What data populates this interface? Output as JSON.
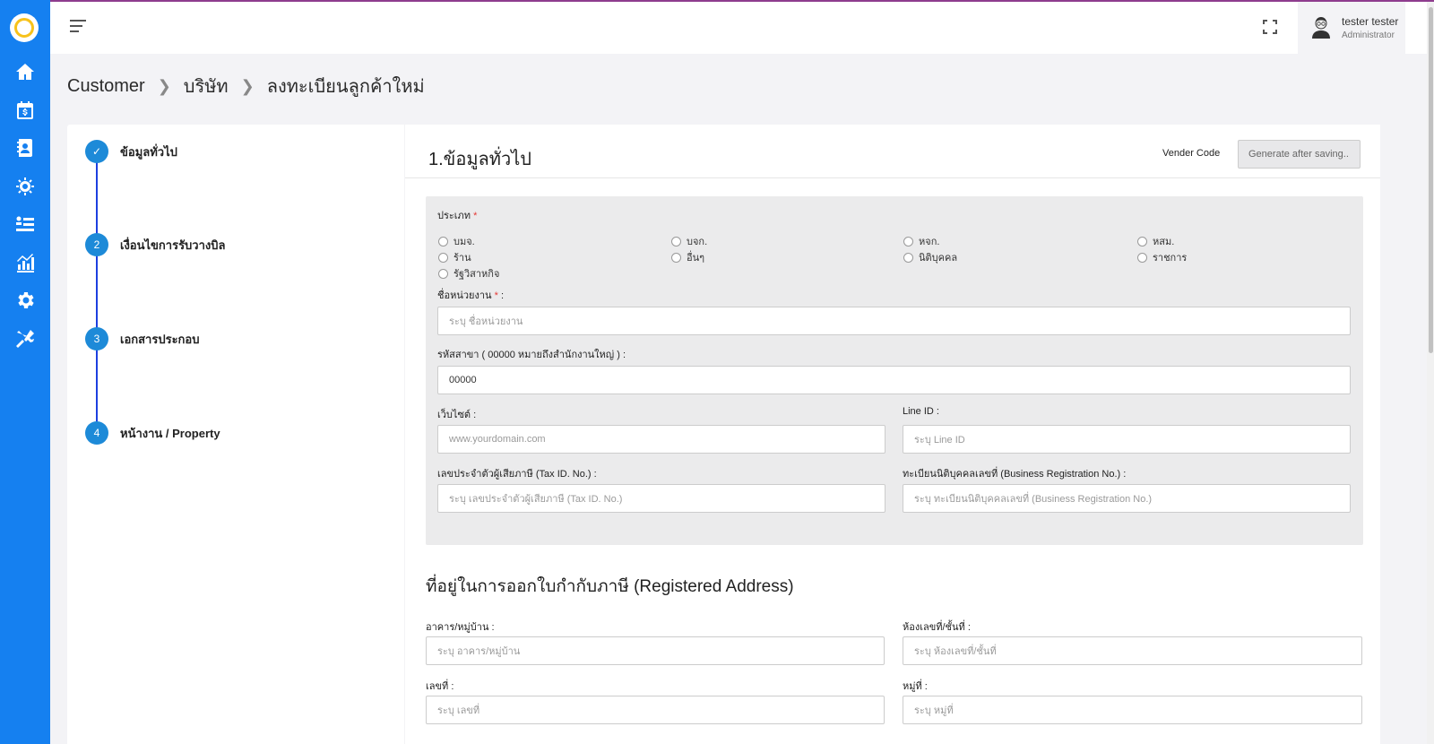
{
  "header": {
    "user_name": "tester tester",
    "user_role": "Administrator"
  },
  "sidebar": {
    "icons": [
      "home-icon",
      "calendar-dollar-icon",
      "contact-book-icon",
      "gear-cluster-icon",
      "list-icon",
      "analytics-icon",
      "settings-icon",
      "tools-icon"
    ]
  },
  "breadcrumb": {
    "items": [
      "Customer",
      "บริษัท",
      "ลงทะเบียนลูกค้าใหม่"
    ]
  },
  "steps": [
    {
      "marker": "✓",
      "label": "ข้อมูลทั่วไป"
    },
    {
      "marker": "2",
      "label": "เงื่อนไขการรับวางบิล"
    },
    {
      "marker": "3",
      "label": "เอกสารประกอบ"
    },
    {
      "marker": "4",
      "label": "หน้างาน / Property"
    }
  ],
  "form": {
    "title": "1.ข้อมูลทั่วไป",
    "vender_code_label": "Vender Code",
    "vender_code_value": "Generate after saving..",
    "type_label": "ประเภท",
    "required_mark": "*",
    "types": [
      "บมจ.",
      "บจก.",
      "หจก.",
      "หสม.",
      "ร้าน",
      "อื่นๆ",
      "นิติบุคคล",
      "ราชการ",
      "รัฐวิสาหกิจ"
    ],
    "org_name_label": "ชื่อหน่วยงาน",
    "org_name_suffix": ":",
    "org_name_placeholder": "ระบุ ชื่อหน่วยงาน",
    "branch_label": "รหัสสาขา ( 00000 หมายถึงสำนักงานใหญ่ ) :",
    "branch_value": "00000",
    "website_label": "เว็บไซต์ :",
    "website_placeholder": "www.yourdomain.com",
    "line_label": "Line ID :",
    "line_placeholder": "ระบุ Line ID",
    "tax_label": "เลขประจำตัวผู้เสียภาษี (Tax ID. No.) :",
    "tax_placeholder": "ระบุ เลขประจำตัวผู้เสียภาษี (Tax ID. No.)",
    "brn_label": "ทะเบียนนิติบุคคลเลขที่ (Business Registration No.) :",
    "brn_placeholder": "ระบุ ทะเบียนนิติบุคคลเลขที่ (Business Registration No.)"
  },
  "address": {
    "title": "ที่อยู่ในการออกใบกำกับภาษี (Registered Address)",
    "building_label": "อาคาร/หมู่บ้าน :",
    "building_placeholder": "ระบุ อาคาร/หมู่บ้าน",
    "room_label": "ห้องเลขที่/ชั้นที่ :",
    "room_placeholder": "ระบุ ห้องเลขที่/ชั้นที่",
    "no_label": "เลขที่ :",
    "no_placeholder": "ระบุ เลขที่",
    "moo_label": "หมู่ที่ :",
    "moo_placeholder": "ระบุ หมู่ที่"
  }
}
